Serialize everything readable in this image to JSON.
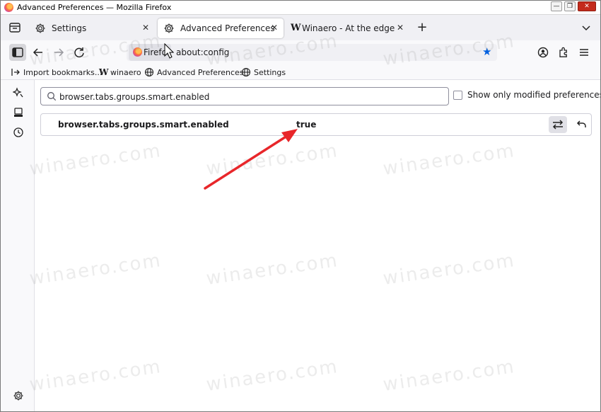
{
  "window": {
    "title": "Advanced Preferences — Mozilla Firefox",
    "minimize": "—",
    "maximize": "❐",
    "close": "✕"
  },
  "tabs": [
    {
      "label": "Settings",
      "icon": "gear-icon",
      "active": false
    },
    {
      "label": "Advanced Preferences",
      "icon": "gear-icon",
      "active": true
    },
    {
      "label": "Winaero - At the edge of tw",
      "icon": "winaero-logo-icon",
      "active": false
    }
  ],
  "tab_close": "✕",
  "new_tab": "+",
  "navbar": {
    "identity_label": "Firefox",
    "url": "about:config"
  },
  "bookmarks": [
    {
      "label": "Import bookmarks...",
      "icon": "import-icon"
    },
    {
      "label": "winaero",
      "icon": "winaero-logo-icon"
    },
    {
      "label": "Advanced Preferences",
      "icon": "globe-icon"
    },
    {
      "label": "Settings",
      "icon": "globe-icon"
    }
  ],
  "winaero_letter": "W",
  "config": {
    "search_value": "browser.tabs.groups.smart.enabled",
    "show_modified_label": "Show only modified preferences",
    "show_modified_checked": false,
    "pref_name": "browser.tabs.groups.smart.enabled",
    "pref_value": "true"
  },
  "watermark": "winaero.com",
  "colors": {
    "accent": "#0060df",
    "annotation_arrow": "#e8262a",
    "close_button": "#c42b1c"
  }
}
